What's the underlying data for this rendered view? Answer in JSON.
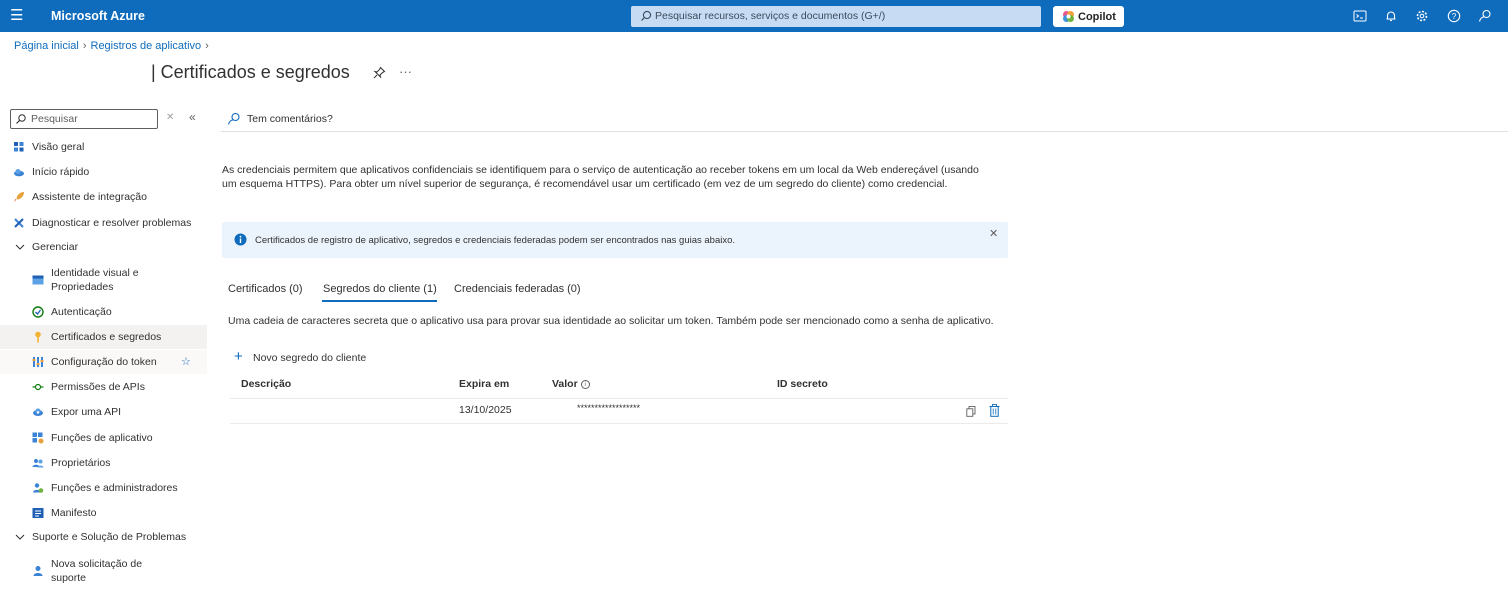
{
  "topbar": {
    "brand": "Microsoft Azure",
    "search_placeholder": "Pesquisar recursos, serviços e documentos (G+/)",
    "copilot_label": "Copilot",
    "color": "#0f6cbd"
  },
  "breadcrumb": {
    "items": [
      "Página inicial",
      "Registros de aplicativo"
    ]
  },
  "page": {
    "title": "| Certificados e segredos",
    "more": "···"
  },
  "sidebar": {
    "search_placeholder": "Pesquisar",
    "items": [
      {
        "label": "Visão geral",
        "icon": "overview-icon"
      },
      {
        "label": "Início rápido",
        "icon": "cloud-icon"
      },
      {
        "label": "Assistente de integração",
        "icon": "rocket-icon"
      },
      {
        "label": "Diagnosticar e resolver problemas",
        "icon": "wrench-icon"
      },
      {
        "label": "Gerenciar",
        "icon": "chevron-down-icon"
      },
      {
        "label": "Identidade visual e",
        "label2": "Propriedades",
        "icon": "branding-icon"
      },
      {
        "label": "Autenticação",
        "icon": "authentication-icon"
      },
      {
        "label": "Certificados e segredos",
        "icon": "key-icon"
      },
      {
        "label": "Configuração do token",
        "icon": "token-icon"
      },
      {
        "label": "Permissões de APIs",
        "icon": "api-permissions-icon"
      },
      {
        "label": "Expor uma API",
        "icon": "cloud-api-icon"
      },
      {
        "label": "Funções de aplicativo",
        "icon": "app-roles-icon"
      },
      {
        "label": "Proprietários",
        "icon": "owners-icon"
      },
      {
        "label": "Funções e administradores",
        "icon": "roles-admins-icon"
      },
      {
        "label": "Manifesto",
        "icon": "manifest-icon"
      },
      {
        "label": "Suporte e Solução de Problemas",
        "icon": "chevron-down-icon"
      },
      {
        "label": "Nova solicitação de",
        "label2": "suporte",
        "icon": "support-icon"
      }
    ]
  },
  "main": {
    "feedback_label": "Tem comentários?",
    "description": "As credenciais permitem que aplicativos confidenciais se identifiquem para o serviço de autenticação ao receber tokens em um local da Web endereçável (usando um esquema HTTPS). Para obter um nível superior de segurança, é recomendável usar um certificado (em vez de um segredo do cliente) como credencial.",
    "info_text": "Certificados de registro de aplicativo, segredos e credenciais federadas podem ser encontrados nas guias abaixo.",
    "tabs": [
      {
        "label": "Certificados (0)"
      },
      {
        "label": "Segredos do cliente (1)",
        "selected": true
      },
      {
        "label": "Credenciais federadas (0)"
      }
    ],
    "tab_description": "Uma cadeia de caracteres secreta que o aplicativo usa para provar sua identidade ao solicitar um token. Também pode ser mencionado como a senha de aplicativo.",
    "new_secret_label": "Novo segredo do cliente",
    "table": {
      "headers": [
        "Descrição",
        "Expira em",
        "Valor",
        "ID secreto"
      ],
      "rows": [
        {
          "descricao": "",
          "expira": "13/10/2025",
          "valor": "******************",
          "id": ""
        }
      ]
    }
  }
}
